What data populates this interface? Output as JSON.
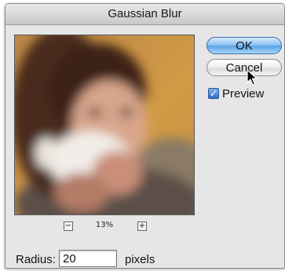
{
  "dialog": {
    "title": "Gaussian Blur",
    "zoom": {
      "minus": "−",
      "plus": "+",
      "level": "13%"
    },
    "buttons": {
      "ok": "OK",
      "cancel": "Cancel"
    },
    "preview": {
      "label": "Preview",
      "checked": true,
      "check_glyph": "✓"
    },
    "radius": {
      "label": "Radius:",
      "value": "20",
      "unit": "pixels"
    }
  },
  "icons": [
    "minus-icon",
    "plus-icon",
    "checkmark-icon",
    "arrow-cursor-icon"
  ],
  "colors": {
    "ok_button": "#5da5e6",
    "checkbox": "#2f6fc8",
    "dialog_bg": "#e6e6e6"
  }
}
